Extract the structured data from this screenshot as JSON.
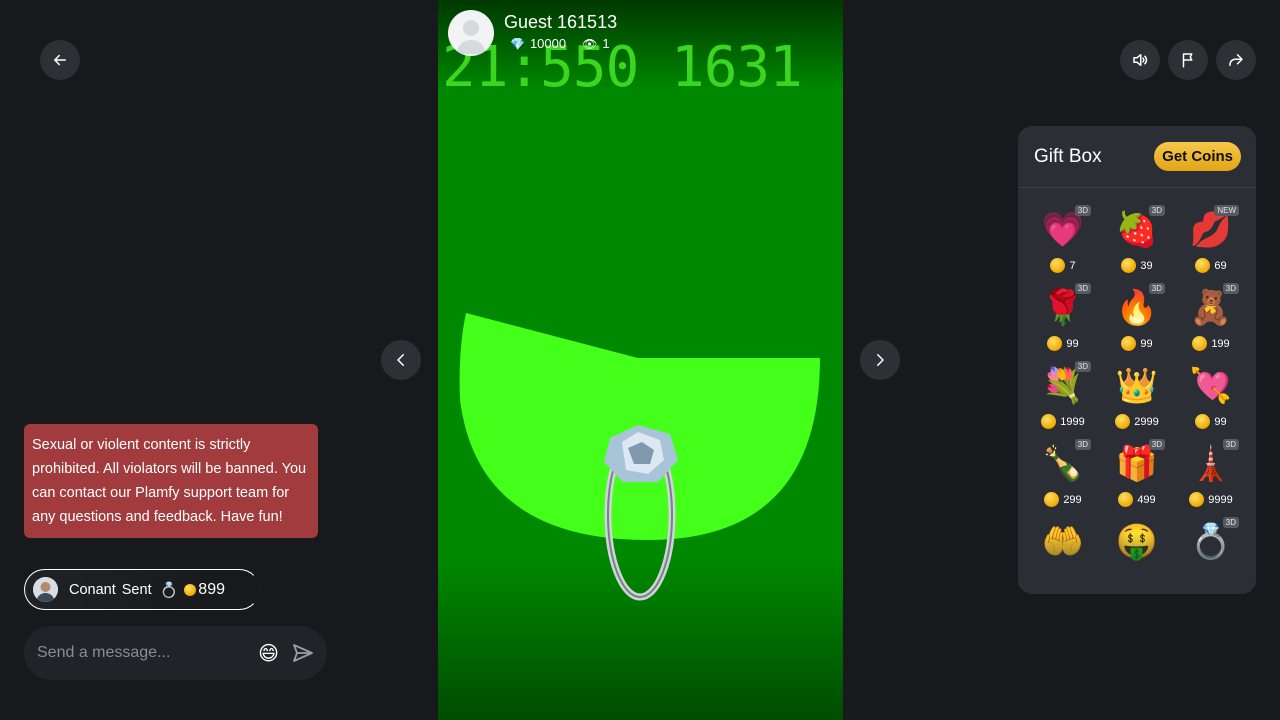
{
  "host": {
    "name": "Guest 161513",
    "diamonds": "10000",
    "viewers": "1"
  },
  "stream": {
    "overlay_clock": "21:550 1631"
  },
  "chat": {
    "notice": "Sexual or violent content is strictly prohibited. All violators will be banned. You can contact our Plamfy support team for any questions and feedback. Have fun!",
    "gift_event": {
      "user": "Conant",
      "verb": "Sent",
      "gift_icon": "ring",
      "amount": "899"
    },
    "input_placeholder": "Send a message..."
  },
  "giftbox": {
    "title": "Gift Box",
    "get_coins_label": "Get Coins",
    "gifts": [
      {
        "name": "follow-me-heart",
        "emoji": "💗",
        "price": "7",
        "badge": "3D"
      },
      {
        "name": "chocolate-strawberry",
        "emoji": "🍓",
        "price": "39",
        "badge": "3D"
      },
      {
        "name": "lips",
        "emoji": "💋",
        "price": "69",
        "badge": "NEW"
      },
      {
        "name": "rose",
        "emoji": "🌹",
        "price": "99",
        "badge": "3D"
      },
      {
        "name": "fire",
        "emoji": "🔥",
        "price": "99",
        "badge": "3D"
      },
      {
        "name": "love-you-bear",
        "emoji": "🧸",
        "price": "199",
        "badge": "3D"
      },
      {
        "name": "rose-bouquet",
        "emoji": "💐",
        "price": "1999",
        "badge": "3D"
      },
      {
        "name": "tiara",
        "emoji": "👑",
        "price": "2999",
        "badge": ""
      },
      {
        "name": "heart-arrow",
        "emoji": "💘",
        "price": "99",
        "badge": ""
      },
      {
        "name": "champagne",
        "emoji": "🍾",
        "price": "299",
        "badge": "3D"
      },
      {
        "name": "chocolate-box",
        "emoji": "🎁",
        "price": "499",
        "badge": "3D"
      },
      {
        "name": "eiffel-tower",
        "emoji": "🗼",
        "price": "9999",
        "badge": "3D"
      },
      {
        "name": "hand-money",
        "emoji": "🤲",
        "price": "",
        "badge": ""
      },
      {
        "name": "money-face",
        "emoji": "🤑",
        "price": "",
        "badge": ""
      },
      {
        "name": "diamond-ring",
        "emoji": "💍",
        "price": "",
        "badge": "3D"
      }
    ]
  }
}
